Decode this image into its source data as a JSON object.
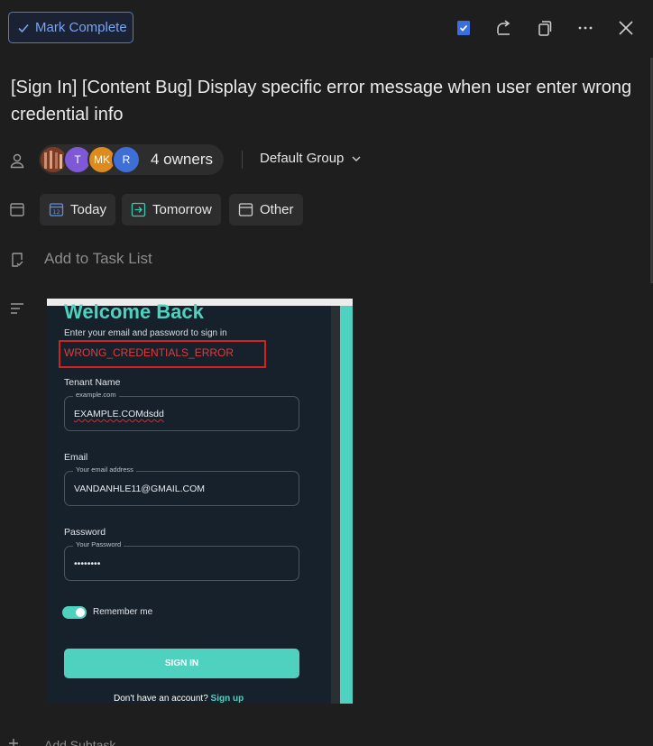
{
  "toolbar": {
    "mark_complete_label": "Mark Complete",
    "icons": [
      "bookmark-check-icon",
      "share-icon",
      "copy-icon",
      "more-icon",
      "close-icon"
    ],
    "accent": "#4c79d8"
  },
  "task": {
    "title": "[Sign In] [Content Bug] Display specific error message when user enter wrong credential info"
  },
  "owners": {
    "avatars": [
      {
        "initials": "",
        "color": "#8a4a2e"
      },
      {
        "initials": "T",
        "color": "#7f58d6"
      },
      {
        "initials": "MK",
        "color": "#dd8a1e"
      },
      {
        "initials": "R",
        "color": "#3d6fd6"
      }
    ],
    "label": "4 owners",
    "group": "Default Group"
  },
  "dates": {
    "today": "Today",
    "today_day": "12",
    "tomorrow": "Tomorrow",
    "other": "Other"
  },
  "task_list": {
    "placeholder": "Add to Task List"
  },
  "attachment": {
    "welcome": "Welcome Back",
    "subtitle": "Enter your email and password to sign in",
    "error": "WRONG_CREDENTIALS_ERROR",
    "tenant": {
      "label": "Tenant Name",
      "legend": "example.com",
      "value": "EXAMPLE.COMdsdd"
    },
    "email": {
      "label": "Email",
      "legend": "Your email address",
      "value": "VANDANHLE11@GMAIL.COM"
    },
    "password": {
      "label": "Password",
      "legend": "Your Password",
      "value": "••••••••"
    },
    "remember": "Remember me",
    "sign_in": "SIGN IN",
    "no_account": "Don't have an account?",
    "sign_up": "Sign up",
    "colors": {
      "brand": "#4fd1c0",
      "error": "#d42222"
    }
  },
  "subtask": {
    "label": "Add Subtask"
  }
}
